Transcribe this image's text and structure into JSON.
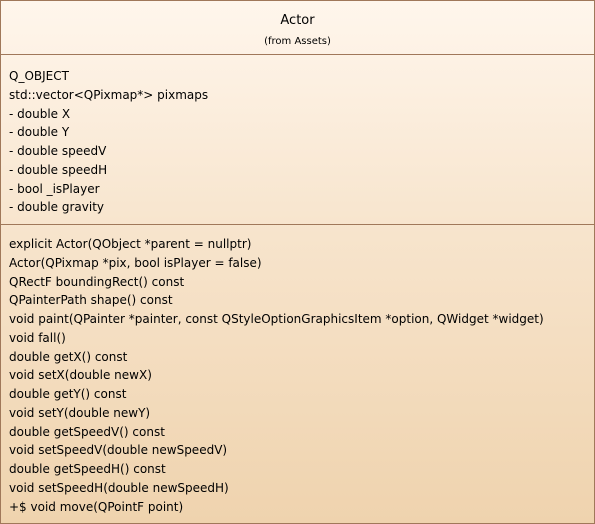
{
  "class": {
    "name": "Actor",
    "stereotype": "(from Assets)"
  },
  "attributes": [
    "Q_OBJECT",
    "std::vector<QPixmap*> pixmaps",
    "- double X",
    "- double Y",
    "- double speedV",
    "- double speedH",
    "- bool _isPlayer",
    "- double gravity"
  ],
  "operations": [
    "explicit Actor(QObject *parent = nullptr)",
    "Actor(QPixmap *pix, bool isPlayer = false)",
    "QRectF boundingRect() const",
    "QPainterPath shape() const",
    "void paint(QPainter *painter, const QStyleOptionGraphicsItem *option, QWidget *widget)",
    "void fall()",
    "double getX() const",
    "void setX(double newX)",
    "double getY() const",
    "void setY(double newY)",
    "double getSpeedV() const",
    "void setSpeedV(double newSpeedV)",
    "double getSpeedH() const",
    "void setSpeedH(double newSpeedH)",
    "+$ void move(QPointF point)"
  ]
}
